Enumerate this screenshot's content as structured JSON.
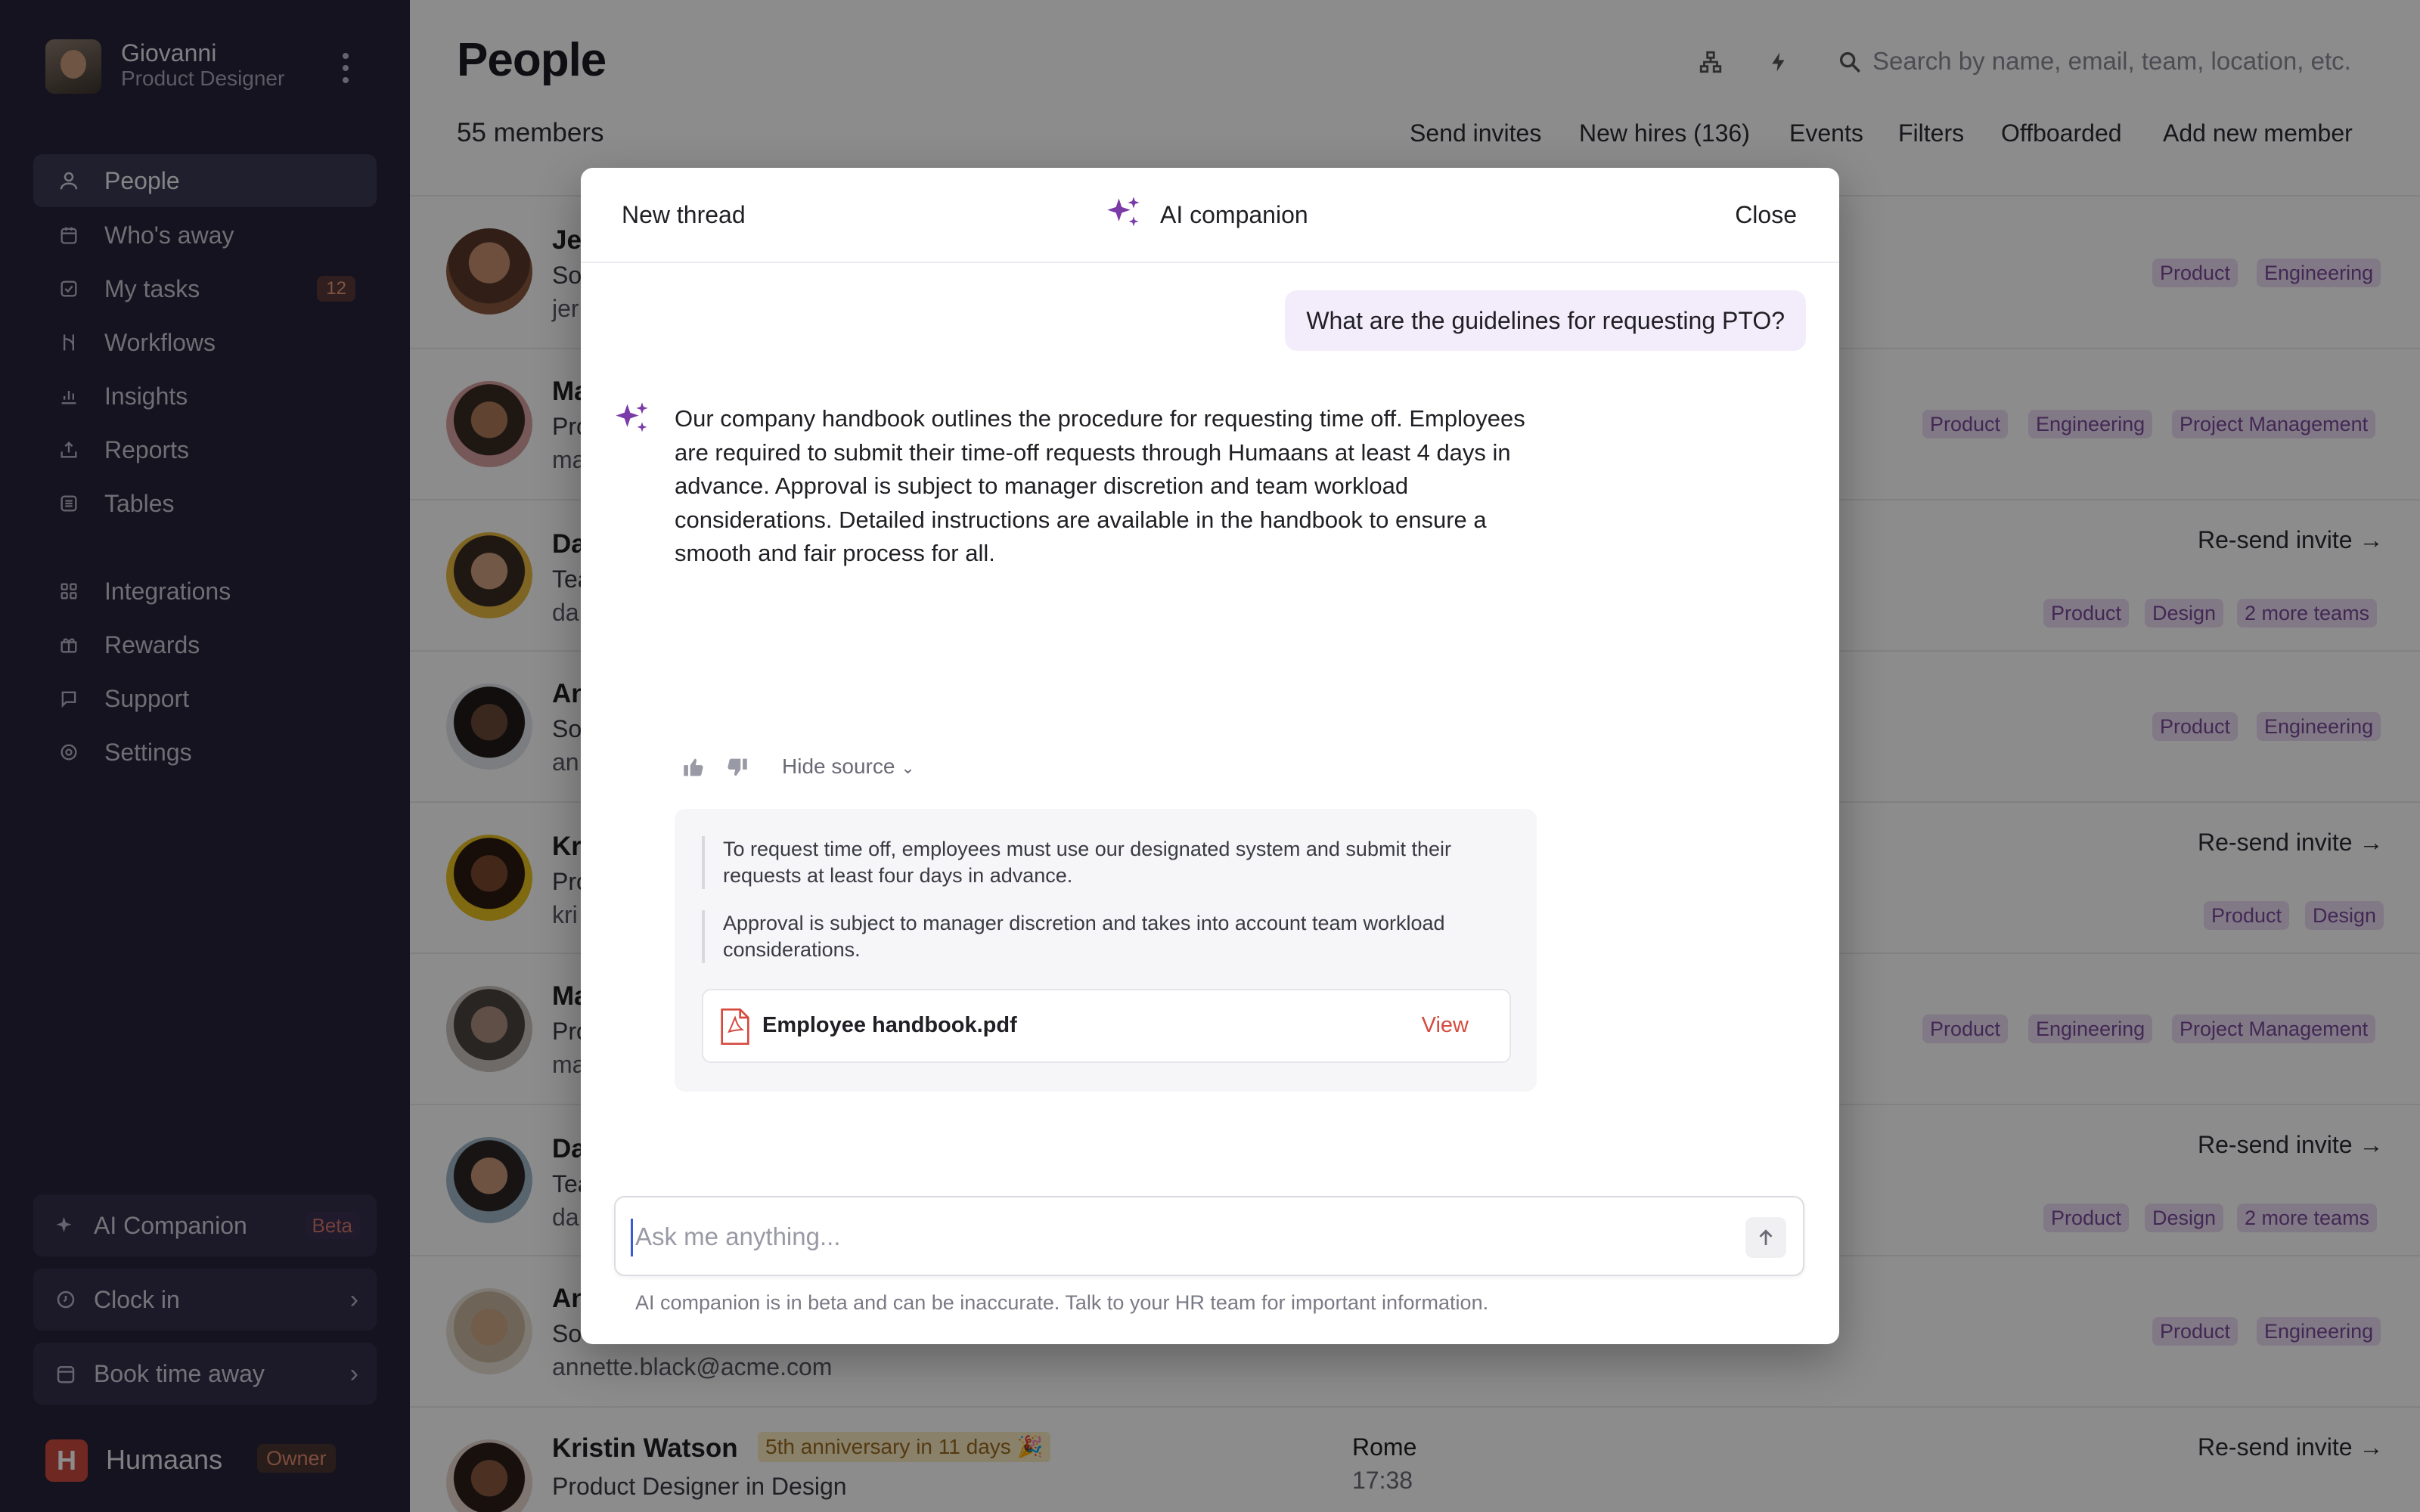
{
  "sidebar": {
    "user": {
      "name": "Giovanni",
      "role": "Product Designer"
    },
    "nav": [
      {
        "label": "People",
        "icon": "person-icon",
        "active": true
      },
      {
        "label": "Who's away",
        "icon": "calendar-icon"
      },
      {
        "label": "My tasks",
        "icon": "checkbox-icon",
        "badge": "12"
      },
      {
        "label": "Workflows",
        "icon": "workflow-icon"
      },
      {
        "label": "Insights",
        "icon": "bar-chart-icon"
      },
      {
        "label": "Reports",
        "icon": "upload-icon"
      },
      {
        "label": "Tables",
        "icon": "table-icon"
      },
      {
        "label": "Integrations",
        "icon": "grid-icon"
      },
      {
        "label": "Rewards",
        "icon": "gift-icon"
      },
      {
        "label": "Support",
        "icon": "chat-icon"
      },
      {
        "label": "Settings",
        "icon": "gear-icon"
      }
    ],
    "ai_companion": {
      "label": "AI Companion",
      "badge": "Beta"
    },
    "clock_in": "Clock in",
    "book_time_away": "Book time away",
    "brand": {
      "mark": "H",
      "name": "Humaans",
      "role_badge": "Owner"
    }
  },
  "main": {
    "title": "People",
    "members": "55 members",
    "search_placeholder": "Search by name, email, team, location, etc.",
    "actions": [
      "Send invites",
      "New hires (136)",
      "Events",
      "Filters",
      "Offboarded",
      "Add new member"
    ],
    "rows": [
      {
        "name": "Je",
        "sub": "So",
        "mail": "jer",
        "tags": [
          "Product",
          "Engineering"
        ]
      },
      {
        "name": "Ma",
        "sub": "Pro",
        "mail": "ma",
        "tags": [
          "Product",
          "Engineering",
          "Project Management"
        ]
      },
      {
        "name": "Da",
        "sub": "Tea",
        "mail": "da",
        "resend": "Re-send invite →",
        "tags": [
          "Product",
          "Design",
          "2 more teams"
        ]
      },
      {
        "name": "An",
        "sub": "So",
        "mail": "an",
        "tags": [
          "Product",
          "Engineering"
        ]
      },
      {
        "name": "Kr",
        "sub": "Pro",
        "mail": "kri",
        "resend": "Re-send invite →",
        "tags": [
          "Product",
          "Design"
        ]
      },
      {
        "name": "Ma",
        "sub": "Pro",
        "mail": "ma",
        "tags": [
          "Product",
          "Engineering",
          "Project Management"
        ]
      },
      {
        "name": "Da",
        "sub": "Tea",
        "mail": "da",
        "resend": "Re-send invite →",
        "tags": [
          "Product",
          "Design",
          "2 more teams"
        ]
      },
      {
        "name": "An",
        "sub": "So",
        "mail": "annette.black@acme.com",
        "tags": [
          "Product",
          "Engineering"
        ]
      },
      {
        "name": "Kristin Watson",
        "sub": "Product Designer in Design",
        "anniversary": "5th anniversary in 11 days 🎉",
        "location": "Rome",
        "time": "17:38",
        "resend": "Re-send invite →"
      }
    ]
  },
  "modal": {
    "new_thread": "New thread",
    "title": "AI companion",
    "close": "Close",
    "user_message": "What are the guidelines for requesting PTO?",
    "ai_message": "Our company handbook outlines the procedure for requesting time off. Employees are required to submit their time-off requests through Humaans at least 4 days in advance. Approval is subject to manager discretion and team workload considerations. Detailed instructions are available in the handbook to ensure a smooth and fair process for all.",
    "hide_source": "Hide source",
    "quotes": [
      "To request time off, employees must use our designated system and submit their requests at least four days in advance.",
      "Approval is subject to manager discretion and takes into account team workload considerations."
    ],
    "file": {
      "name": "Employee handbook.pdf",
      "action": "View"
    },
    "input_placeholder": "Ask me anything...",
    "disclaimer": "AI companion is in beta and can be inaccurate. Talk to your HR team for important information."
  },
  "colors": {
    "sidebar_bg": "#252339",
    "accent_purple": "#7a3aa8",
    "tag_bg": "#ecdcf5",
    "pdf_red": "#d64a3e"
  }
}
